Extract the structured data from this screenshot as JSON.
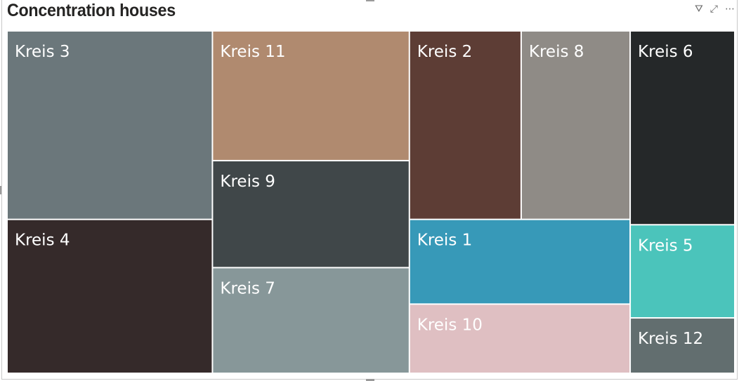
{
  "visual": {
    "title": "Concentration houses",
    "toolbar": [
      {
        "icon": "filter-icon",
        "glyph": "⛛"
      },
      {
        "icon": "focus-mode-icon",
        "glyph": "⤢"
      },
      {
        "icon": "more-options-icon",
        "glyph": "⋯"
      }
    ]
  },
  "chart_data": {
    "type": "treemap",
    "title": "Concentration houses",
    "items": [
      {
        "label": "Kreis 3",
        "value": 14.7,
        "color": "#6b777b"
      },
      {
        "label": "Kreis 4",
        "value": 12.0,
        "color": "#352a2a"
      },
      {
        "label": "Kreis 11",
        "value": 9.7,
        "color": "#b08a6f"
      },
      {
        "label": "Kreis 9",
        "value": 8.0,
        "color": "#404749"
      },
      {
        "label": "Kreis 7",
        "value": 7.9,
        "color": "#879799"
      },
      {
        "label": "Kreis 2",
        "value": 8.0,
        "color": "#5d3d35"
      },
      {
        "label": "Kreis 8",
        "value": 7.8,
        "color": "#8f8b86"
      },
      {
        "label": "Kreis 6",
        "value": 7.7,
        "color": "#252829"
      },
      {
        "label": "Kreis 1",
        "value": 7.1,
        "color": "#3799b8"
      },
      {
        "label": "Kreis 10",
        "value": 5.8,
        "color": "#dfbfc2"
      },
      {
        "label": "Kreis 5",
        "value": 3.7,
        "color": "#4bc4bb"
      },
      {
        "label": "Kreis 12",
        "value": 2.2,
        "color": "#626e6f"
      }
    ]
  }
}
